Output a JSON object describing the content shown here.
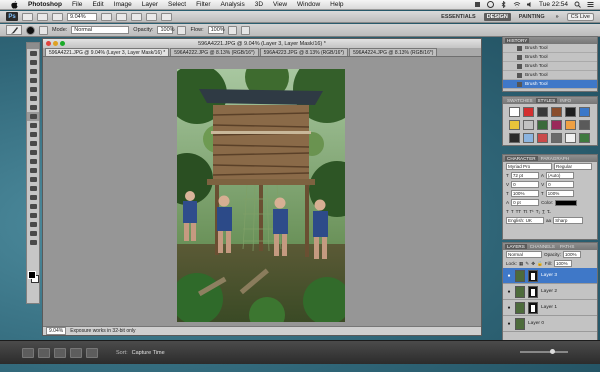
{
  "menubar": {
    "app": "Photoshop",
    "items": [
      "File",
      "Edit",
      "Image",
      "Layer",
      "Select",
      "Filter",
      "Analysis",
      "3D",
      "View",
      "Window",
      "Help"
    ],
    "clock": "Tue 22:54"
  },
  "appbar": {
    "logo": "Ps",
    "zoom": "9.04%",
    "workspaces": [
      "ESSENTIALS",
      "DESIGN",
      "PAINTING"
    ],
    "active_workspace": "DESIGN",
    "more": "»",
    "cs_live": "CS Live"
  },
  "options": {
    "mode_label": "Mode:",
    "mode_value": "Normal",
    "opacity_label": "Opacity:",
    "opacity_value": "100%",
    "flow_label": "Flow:",
    "flow_value": "100%"
  },
  "document": {
    "title": "596A4221.JPG @ 9.04% (Layer 3, Layer Mask/16) *",
    "tabs": [
      "596A4221.JPG @ 9.04% (Layer 3, Layer Mask/16) *",
      "596A4222.JPG @ 8.13% (RGB/16*)",
      "596A4223.JPG @ 8.13% (RGB/16*)",
      "596A4224.JPG @ 8.13% (RGB/16*)"
    ],
    "status_zoom": "9.04%",
    "status_text": "Exposure works in 32-bit only"
  },
  "history": {
    "tab": "HISTORY",
    "items": [
      "Brush Tool",
      "Brush Tool",
      "Brush Tool",
      "Brush Tool",
      "Brush Tool",
      "Brush Tool"
    ],
    "selected_index": 5
  },
  "swatches_panel": {
    "tabs": [
      "SWATCHES",
      "STYLES",
      "INFO"
    ],
    "active": "STYLES",
    "colors": [
      "#ffffff",
      "#d32f2f",
      "#3a3a3a",
      "#8a4d2b",
      "#1f1f1f",
      "#3b78c8",
      "#e9c33a",
      "#c2c2c2",
      "#3a6a3a",
      "#9a2a5a",
      "#efa043",
      "#5a5a5a",
      "#2b2b2b",
      "#8bb4e0",
      "#c94a4a",
      "#6a6a6a",
      "#f0f0f0",
      "#3f7a3f"
    ]
  },
  "character_panel": {
    "tabs": [
      "CHARACTER",
      "PARAGRAPH"
    ],
    "font": "Myriad Pro",
    "style": "Regular",
    "size": "72 pt",
    "leading": "(Auto)",
    "kerning": "0",
    "tracking": "0",
    "vscale": "100%",
    "hscale": "100%",
    "baseline": "0 pt",
    "color_label": "Color:",
    "language": "English: UK",
    "aa": "Sharp"
  },
  "layers_panel": {
    "tabs": [
      "LAYERS",
      "CHANNELS",
      "PATHS"
    ],
    "blend_mode": "Normal",
    "opacity_label": "Opacity:",
    "opacity_value": "100%",
    "lock_label": "Lock:",
    "fill_label": "Fill:",
    "fill_value": "100%",
    "layers": [
      "Layer 3",
      "Layer 2",
      "Layer 1",
      "Layer 0"
    ],
    "selected_index": 0
  },
  "bottombar": {
    "sort_label": "Sort:",
    "sort_value": "Capture Time"
  }
}
